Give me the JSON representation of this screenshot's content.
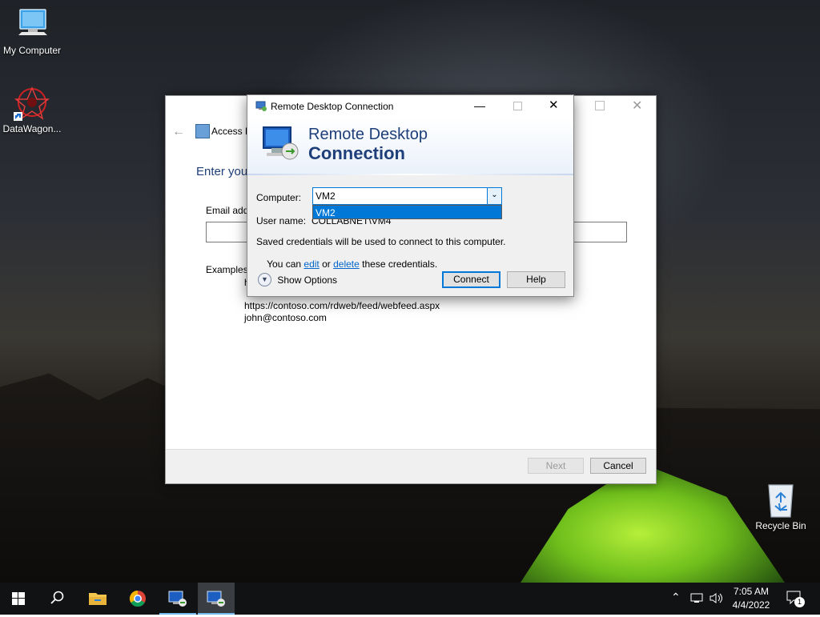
{
  "desktop": {
    "icons": [
      {
        "label": "My Computer"
      },
      {
        "label": "DataWagon..."
      },
      {
        "label": "Recycle Bin"
      }
    ]
  },
  "wizard": {
    "title": "Access R",
    "heading": "Enter you",
    "email_label": "Email add",
    "examples_label": "Examples:",
    "example_partial": "h",
    "example_line2": "https://contoso.com/rdweb/feed/webfeed.aspx",
    "example_line3": "john@contoso.com",
    "next_label": "Next",
    "cancel_label": "Cancel"
  },
  "rdc": {
    "title": "Remote Desktop Connection",
    "banner_line1": "Remote Desktop",
    "banner_line2": "Connection",
    "computer_label": "Computer:",
    "computer_value": "VM2",
    "dropdown_options": [
      "VM2"
    ],
    "username_label": "User name:",
    "username_value": "COLLABNET\\VM4",
    "saved_text": "Saved credentials will be used to connect to this computer.",
    "you_can": "You can ",
    "edit_link": "edit",
    "or_text": " or ",
    "delete_link": "delete",
    "these_creds": " these credentials.",
    "show_options": "Show Options",
    "connect_label": "Connect",
    "help_label": "Help"
  },
  "taskbar": {
    "time": "7:05 AM",
    "date": "4/4/2022",
    "notification_count": "1"
  },
  "colors": {
    "accent": "#0078d7",
    "selection": "#0078d7",
    "banner_text": "#1e3f7a",
    "link": "#0066cc"
  }
}
